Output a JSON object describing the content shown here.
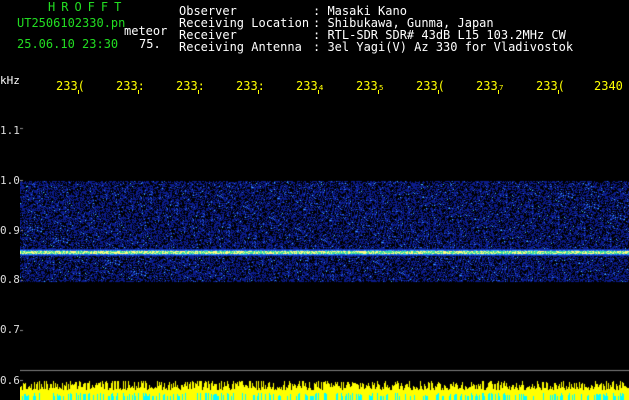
{
  "header": {
    "brand": "HROFFT",
    "filename": "UT2506102330.pn",
    "label_meteor": "meteor",
    "datetime": "25.06.10 23:30",
    "count": "75.",
    "info": [
      {
        "key": "Observer",
        "value": ": Masaki Kano"
      },
      {
        "key": "Receiving Location",
        "value": ": Shibukawa, Gunma, Japan"
      },
      {
        "key": "Receiver",
        "value": ": RTL-SDR SDR# 43dB L15 103.2MHz CW"
      },
      {
        "key": "Receiving Antenna",
        "value": ": 3el Yagi(V) Az 330 for Vladivostok"
      }
    ]
  },
  "axis": {
    "y_unit": "kHz",
    "y_ticks": [
      "1.1",
      "1.0",
      "0.9",
      "0.8",
      "0.7",
      "0.6"
    ],
    "time_ticks": [
      "233(",
      "233:",
      "233:",
      "233:",
      "233₄",
      "233₅",
      "233(",
      "233₇",
      "233(",
      "233(",
      "2340"
    ]
  },
  "colors": {
    "text_green": "#22dd22",
    "tick_yellow": "#ffff00",
    "background": "#000000",
    "signal_line": "#ffff80",
    "noise_blue": "#1e3cd2"
  }
}
